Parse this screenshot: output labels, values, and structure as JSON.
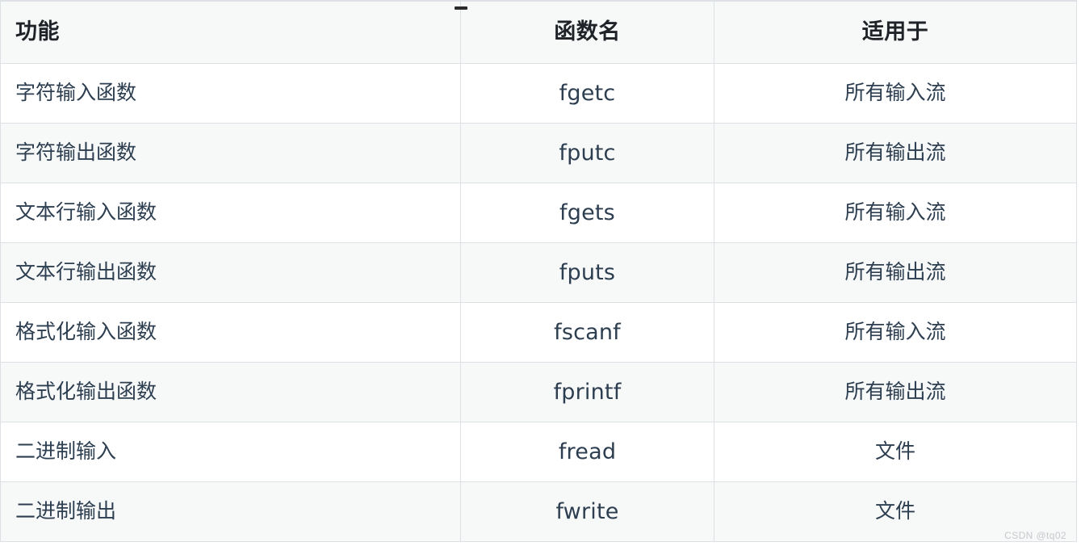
{
  "page": {
    "watermark": "CSDN @tq02",
    "background_color": "#ffffff"
  },
  "table": {
    "name": "c-file-io-functions",
    "style": {
      "header_bg": "#f7f8f8",
      "row_bg_odd": "#ffffff",
      "row_bg_even": "#f7f8f8",
      "border_color": "#dde1e5",
      "text_color": "#24292f",
      "header_text_color": "#1f2328"
    },
    "columns": [
      {
        "key": "feature",
        "label": "功能",
        "align": "left"
      },
      {
        "key": "fname",
        "label": "函数名",
        "align": "center"
      },
      {
        "key": "apply",
        "label": "适用于",
        "align": "center"
      }
    ],
    "rows": [
      {
        "feature": "字符输入函数",
        "fname": "fgetc",
        "apply": "所有输入流"
      },
      {
        "feature": "字符输出函数",
        "fname": "fputc",
        "apply": "所有输出流"
      },
      {
        "feature": "文本行输入函数",
        "fname": "fgets",
        "apply": "所有输入流"
      },
      {
        "feature": "文本行输出函数",
        "fname": "fputs",
        "apply": "所有输出流"
      },
      {
        "feature": "格式化输入函数",
        "fname": "fscanf",
        "apply": "所有输入流"
      },
      {
        "feature": "格式化输出函数",
        "fname": "fprintf",
        "apply": "所有输出流"
      },
      {
        "feature": "二进制输入",
        "fname": "fread",
        "apply": "文件"
      },
      {
        "feature": "二进制输出",
        "fname": "fwrite",
        "apply": "文件"
      }
    ]
  }
}
